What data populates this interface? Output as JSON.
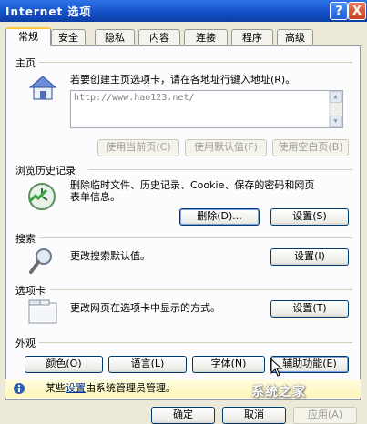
{
  "window": {
    "title": "Internet 选项",
    "help": "?",
    "close": "X"
  },
  "tabs": [
    "常规",
    "安全",
    "隐私",
    "内容",
    "连接",
    "程序",
    "高级"
  ],
  "home": {
    "title": "主页",
    "desc": "若要创建主页选项卡，请在各地址行键入地址(R)。",
    "url": "http://www.hao123.net/",
    "buttons": [
      "使用当前页(C)",
      "使用默认值(F)",
      "使用空白页(B)"
    ]
  },
  "history": {
    "title": "浏览历史记录",
    "desc1": "删除临时文件、历史记录、Cookie、保存的密码和网页",
    "desc2": "表单信息。",
    "delete": "删除(D)...",
    "settings": "设置(S)"
  },
  "search": {
    "title": "搜索",
    "desc": "更改搜索默认值。",
    "settings": "设置(I)"
  },
  "tabsgroup": {
    "title": "选项卡",
    "desc": "更改网页在选项卡中显示的方式。",
    "settings": "设置(T)"
  },
  "appearance": {
    "title": "外观",
    "buttons": [
      "颜色(O)",
      "语言(L)",
      "字体(N)",
      "辅助功能(E)"
    ]
  },
  "info": {
    "pre": "某些",
    "link": "设置",
    "post": "由系统管理员管理。"
  },
  "footer": {
    "ok": "确定",
    "cancel": "取消",
    "apply": "应用(A)"
  },
  "watermark": "系统之家"
}
